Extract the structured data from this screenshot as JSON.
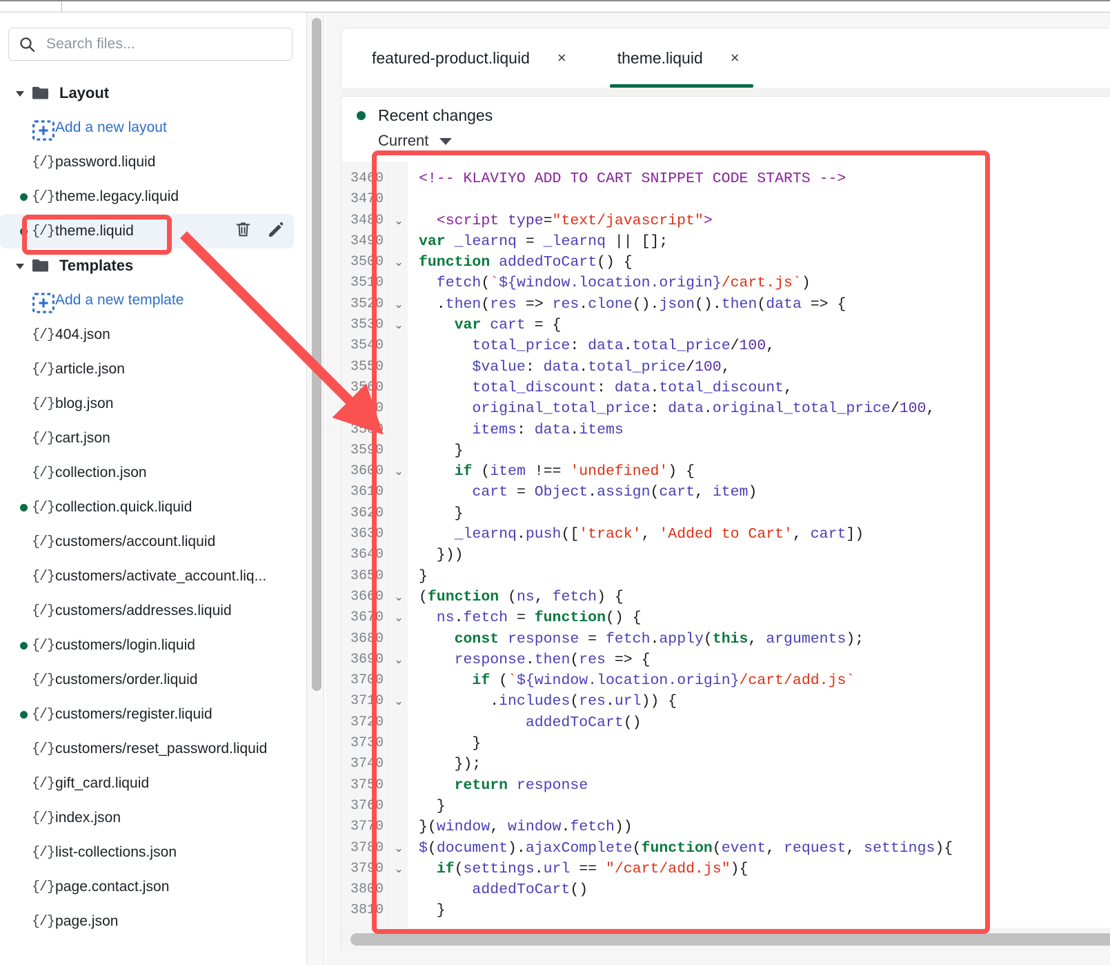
{
  "search": {
    "placeholder": "Search files..."
  },
  "tree": [
    {
      "type": "group",
      "label": "Layout"
    },
    {
      "type": "add",
      "label": "Add a new layout"
    },
    {
      "type": "file",
      "label": "password.liquid",
      "modified": false
    },
    {
      "type": "file",
      "label": "theme.legacy.liquid",
      "modified": true
    },
    {
      "type": "file",
      "label": "theme.liquid",
      "modified": true,
      "selected": true
    },
    {
      "type": "group",
      "label": "Templates"
    },
    {
      "type": "add",
      "label": "Add a new template"
    },
    {
      "type": "file",
      "label": "404.json",
      "modified": false
    },
    {
      "type": "file",
      "label": "article.json",
      "modified": false
    },
    {
      "type": "file",
      "label": "blog.json",
      "modified": false
    },
    {
      "type": "file",
      "label": "cart.json",
      "modified": false
    },
    {
      "type": "file",
      "label": "collection.json",
      "modified": false
    },
    {
      "type": "file",
      "label": "collection.quick.liquid",
      "modified": true
    },
    {
      "type": "file",
      "label": "customers/account.liquid",
      "modified": false
    },
    {
      "type": "file",
      "label": "customers/activate_account.liq...",
      "modified": false
    },
    {
      "type": "file",
      "label": "customers/addresses.liquid",
      "modified": false
    },
    {
      "type": "file",
      "label": "customers/login.liquid",
      "modified": true
    },
    {
      "type": "file",
      "label": "customers/order.liquid",
      "modified": false
    },
    {
      "type": "file",
      "label": "customers/register.liquid",
      "modified": true
    },
    {
      "type": "file",
      "label": "customers/reset_password.liquid",
      "modified": false
    },
    {
      "type": "file",
      "label": "gift_card.liquid",
      "modified": false
    },
    {
      "type": "file",
      "label": "index.json",
      "modified": false
    },
    {
      "type": "file",
      "label": "list-collections.json",
      "modified": false
    },
    {
      "type": "file",
      "label": "page.contact.json",
      "modified": false
    },
    {
      "type": "file",
      "label": "page.json",
      "modified": false
    }
  ],
  "row_actions": {
    "delete": "delete-file",
    "edit": "rename-file"
  },
  "tabs": [
    {
      "label": "featured-product.liquid",
      "close": "×",
      "active": false
    },
    {
      "label": "theme.liquid",
      "close": "×",
      "active": true
    }
  ],
  "changes": {
    "title": "Recent changes",
    "selected_version": "Current"
  },
  "editor": {
    "first_line": 3460,
    "lines": [
      {
        "n": "3460",
        "fold": "",
        "tokens": [
          [
            "tkc",
            "<!-- KLAVIYO ADD TO CART SNIPPET CODE STARTS -->"
          ]
        ]
      },
      {
        "n": "3470",
        "fold": "",
        "tokens": [
          [
            "tkn",
            ""
          ]
        ]
      },
      {
        "n": "3480",
        "fold": "v",
        "tokens": [
          [
            "tkn",
            "  "
          ],
          [
            "tkc",
            "<script "
          ],
          [
            "tka",
            "type"
          ],
          [
            "tkn",
            "="
          ],
          [
            "tks",
            "\"text/javascript\""
          ],
          [
            "tkc",
            ">"
          ]
        ]
      },
      {
        "n": "3490",
        "fold": "",
        "tokens": [
          [
            "tkk",
            "var"
          ],
          [
            "tkp",
            " _learnq "
          ],
          [
            "tkn",
            "= "
          ],
          [
            "tkp",
            "_learnq "
          ],
          [
            "tkn",
            "|| [];"
          ]
        ]
      },
      {
        "n": "3500",
        "fold": "v",
        "tokens": [
          [
            "tkk",
            "function"
          ],
          [
            "tkp",
            " addedToCart"
          ],
          [
            "tkn",
            "() {"
          ]
        ]
      },
      {
        "n": "3510",
        "fold": "",
        "tokens": [
          [
            "tkp",
            "  fetch"
          ],
          [
            "tkn",
            "("
          ],
          [
            "tks",
            "`"
          ],
          [
            "tkp",
            "${window.location.origin}"
          ],
          [
            "tks",
            "/cart.js`"
          ],
          [
            "tkn",
            ")"
          ]
        ]
      },
      {
        "n": "3520",
        "fold": "v",
        "tokens": [
          [
            "tkn",
            "  ."
          ],
          [
            "tkp",
            "then"
          ],
          [
            "tkn",
            "("
          ],
          [
            "tkp",
            "res "
          ],
          [
            "tkn",
            "=> "
          ],
          [
            "tkp",
            "res"
          ],
          [
            "tkn",
            "."
          ],
          [
            "tkp",
            "clone"
          ],
          [
            "tkn",
            "()."
          ],
          [
            "tkp",
            "json"
          ],
          [
            "tkn",
            "()."
          ],
          [
            "tkp",
            "then"
          ],
          [
            "tkn",
            "("
          ],
          [
            "tkp",
            "data "
          ],
          [
            "tkn",
            "=> {"
          ]
        ]
      },
      {
        "n": "3530",
        "fold": "v",
        "tokens": [
          [
            "tkn",
            "    "
          ],
          [
            "tkk",
            "var"
          ],
          [
            "tkp",
            " cart "
          ],
          [
            "tkn",
            "= {"
          ]
        ]
      },
      {
        "n": "3540",
        "fold": "",
        "tokens": [
          [
            "tkp",
            "      total_price"
          ],
          [
            "tkn",
            ": "
          ],
          [
            "tkp",
            "data"
          ],
          [
            "tkn",
            "."
          ],
          [
            "tkp",
            "total_price"
          ],
          [
            "tkn",
            "/"
          ],
          [
            "tka",
            "100"
          ],
          [
            "tkn",
            ","
          ]
        ]
      },
      {
        "n": "3550",
        "fold": "",
        "tokens": [
          [
            "tkp",
            "      $value"
          ],
          [
            "tkn",
            ": "
          ],
          [
            "tkp",
            "data"
          ],
          [
            "tkn",
            "."
          ],
          [
            "tkp",
            "total_price"
          ],
          [
            "tkn",
            "/"
          ],
          [
            "tka",
            "100"
          ],
          [
            "tkn",
            ","
          ]
        ]
      },
      {
        "n": "3560",
        "fold": "",
        "tokens": [
          [
            "tkp",
            "      total_discount"
          ],
          [
            "tkn",
            ": "
          ],
          [
            "tkp",
            "data"
          ],
          [
            "tkn",
            "."
          ],
          [
            "tkp",
            "total_discount"
          ],
          [
            "tkn",
            ","
          ]
        ]
      },
      {
        "n": "3570",
        "fold": "",
        "tokens": [
          [
            "tkp",
            "      original_total_price"
          ],
          [
            "tkn",
            ": "
          ],
          [
            "tkp",
            "data"
          ],
          [
            "tkn",
            "."
          ],
          [
            "tkp",
            "original_total_price"
          ],
          [
            "tkn",
            "/"
          ],
          [
            "tka",
            "100"
          ],
          [
            "tkn",
            ","
          ]
        ]
      },
      {
        "n": "3580",
        "fold": "",
        "tokens": [
          [
            "tkp",
            "      items"
          ],
          [
            "tkn",
            ": "
          ],
          [
            "tkp",
            "data"
          ],
          [
            "tkn",
            "."
          ],
          [
            "tkp",
            "items"
          ]
        ]
      },
      {
        "n": "3590",
        "fold": "",
        "tokens": [
          [
            "tkn",
            "    }"
          ]
        ]
      },
      {
        "n": "3600",
        "fold": "v",
        "tokens": [
          [
            "tkn",
            "    "
          ],
          [
            "tkk",
            "if"
          ],
          [
            "tkn",
            " ("
          ],
          [
            "tkp",
            "item "
          ],
          [
            "tkn",
            "!== "
          ],
          [
            "tks",
            "'undefined'"
          ],
          [
            "tkn",
            ") {"
          ]
        ]
      },
      {
        "n": "3610",
        "fold": "",
        "tokens": [
          [
            "tkp",
            "      cart "
          ],
          [
            "tkn",
            "= "
          ],
          [
            "tkp",
            "Object"
          ],
          [
            "tkn",
            "."
          ],
          [
            "tkp",
            "assign"
          ],
          [
            "tkn",
            "("
          ],
          [
            "tkp",
            "cart"
          ],
          [
            "tkn",
            ", "
          ],
          [
            "tkp",
            "item"
          ],
          [
            "tkn",
            ")"
          ]
        ]
      },
      {
        "n": "3620",
        "fold": "",
        "tokens": [
          [
            "tkn",
            "    }"
          ]
        ]
      },
      {
        "n": "3630",
        "fold": "",
        "tokens": [
          [
            "tkp",
            "    _learnq"
          ],
          [
            "tkn",
            "."
          ],
          [
            "tkp",
            "push"
          ],
          [
            "tkn",
            "(["
          ],
          [
            "tks",
            "'track'"
          ],
          [
            "tkn",
            ", "
          ],
          [
            "tks",
            "'Added to Cart'"
          ],
          [
            "tkn",
            ", "
          ],
          [
            "tkp",
            "cart"
          ],
          [
            "tkn",
            "])"
          ]
        ]
      },
      {
        "n": "3640",
        "fold": "",
        "tokens": [
          [
            "tkn",
            "  }))"
          ]
        ]
      },
      {
        "n": "3650",
        "fold": "",
        "tokens": [
          [
            "tkn",
            "}"
          ]
        ]
      },
      {
        "n": "3660",
        "fold": "v",
        "tokens": [
          [
            "tkn",
            "("
          ],
          [
            "tkk",
            "function"
          ],
          [
            "tkn",
            " ("
          ],
          [
            "tkp",
            "ns"
          ],
          [
            "tkn",
            ", "
          ],
          [
            "tkp",
            "fetch"
          ],
          [
            "tkn",
            ") {"
          ]
        ]
      },
      {
        "n": "3670",
        "fold": "v",
        "tokens": [
          [
            "tkp",
            "  ns"
          ],
          [
            "tkn",
            "."
          ],
          [
            "tkp",
            "fetch "
          ],
          [
            "tkn",
            "= "
          ],
          [
            "tkk",
            "function"
          ],
          [
            "tkn",
            "() {"
          ]
        ]
      },
      {
        "n": "3680",
        "fold": "",
        "tokens": [
          [
            "tkn",
            "    "
          ],
          [
            "tkk",
            "const"
          ],
          [
            "tkp",
            " response "
          ],
          [
            "tkn",
            "= "
          ],
          [
            "tkp",
            "fetch"
          ],
          [
            "tkn",
            "."
          ],
          [
            "tkp",
            "apply"
          ],
          [
            "tkn",
            "("
          ],
          [
            "tkk",
            "this"
          ],
          [
            "tkn",
            ", "
          ],
          [
            "tkp",
            "arguments"
          ],
          [
            "tkn",
            ");"
          ]
        ]
      },
      {
        "n": "3690",
        "fold": "v",
        "tokens": [
          [
            "tkp",
            "    response"
          ],
          [
            "tkn",
            "."
          ],
          [
            "tkp",
            "then"
          ],
          [
            "tkn",
            "("
          ],
          [
            "tkp",
            "res "
          ],
          [
            "tkn",
            "=> {"
          ]
        ]
      },
      {
        "n": "3700",
        "fold": "",
        "tokens": [
          [
            "tkn",
            "      "
          ],
          [
            "tkk",
            "if"
          ],
          [
            "tkn",
            " ("
          ],
          [
            "tks",
            "`"
          ],
          [
            "tkp",
            "${window.location.origin}"
          ],
          [
            "tks",
            "/cart/add.js`"
          ]
        ]
      },
      {
        "n": "3710",
        "fold": "v",
        "tokens": [
          [
            "tkn",
            "        ."
          ],
          [
            "tkp",
            "includes"
          ],
          [
            "tkn",
            "("
          ],
          [
            "tkp",
            "res"
          ],
          [
            "tkn",
            "."
          ],
          [
            "tkp",
            "url"
          ],
          [
            "tkn",
            ")) {"
          ]
        ]
      },
      {
        "n": "3720",
        "fold": "",
        "tokens": [
          [
            "tkp",
            "            addedToCart"
          ],
          [
            "tkn",
            "()"
          ]
        ]
      },
      {
        "n": "3730",
        "fold": "",
        "tokens": [
          [
            "tkn",
            "      }"
          ]
        ]
      },
      {
        "n": "3740",
        "fold": "",
        "tokens": [
          [
            "tkn",
            "    });"
          ]
        ]
      },
      {
        "n": "3750",
        "fold": "",
        "tokens": [
          [
            "tkn",
            "    "
          ],
          [
            "tkk",
            "return"
          ],
          [
            "tkp",
            " response"
          ]
        ]
      },
      {
        "n": "3760",
        "fold": "",
        "tokens": [
          [
            "tkn",
            "  }"
          ]
        ]
      },
      {
        "n": "3770",
        "fold": "",
        "tokens": [
          [
            "tkn",
            "}("
          ],
          [
            "tkp",
            "window"
          ],
          [
            "tkn",
            ", "
          ],
          [
            "tkp",
            "window"
          ],
          [
            "tkn",
            "."
          ],
          [
            "tkp",
            "fetch"
          ],
          [
            "tkn",
            "))"
          ]
        ]
      },
      {
        "n": "3780",
        "fold": "v",
        "tokens": [
          [
            "tkp",
            "$"
          ],
          [
            "tkn",
            "("
          ],
          [
            "tkp",
            "document"
          ],
          [
            "tkn",
            ")."
          ],
          [
            "tkp",
            "ajaxComplete"
          ],
          [
            "tkn",
            "("
          ],
          [
            "tkk",
            "function"
          ],
          [
            "tkn",
            "("
          ],
          [
            "tkp",
            "event"
          ],
          [
            "tkn",
            ", "
          ],
          [
            "tkp",
            "request"
          ],
          [
            "tkn",
            ", "
          ],
          [
            "tkp",
            "settings"
          ],
          [
            "tkn",
            "){"
          ]
        ]
      },
      {
        "n": "3790",
        "fold": "v",
        "tokens": [
          [
            "tkn",
            "  "
          ],
          [
            "tkk",
            "if"
          ],
          [
            "tkn",
            "("
          ],
          [
            "tkp",
            "settings"
          ],
          [
            "tkn",
            "."
          ],
          [
            "tkp",
            "url "
          ],
          [
            "tkn",
            "== "
          ],
          [
            "tks",
            "\"/cart/add.js\""
          ],
          [
            "tkn",
            "){"
          ]
        ]
      },
      {
        "n": "3800",
        "fold": "",
        "tokens": [
          [
            "tkp",
            "      addedToCart"
          ],
          [
            "tkn",
            "()"
          ]
        ]
      },
      {
        "n": "3810",
        "fold": "",
        "tokens": [
          [
            "tkn",
            "  }"
          ]
        ]
      }
    ]
  },
  "annotations": {
    "highlight_file": "theme.liquid",
    "highlight_color": "#fa5151",
    "arrow": "points from theme.liquid file row to the code block"
  }
}
